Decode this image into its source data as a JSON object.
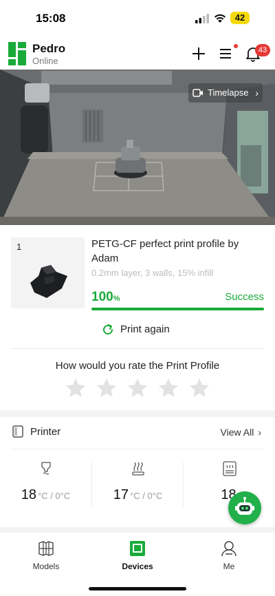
{
  "status_bar": {
    "time": "15:08",
    "battery": "42"
  },
  "header": {
    "device_name": "Pedro",
    "device_status": "Online",
    "notification_count": "43"
  },
  "camera": {
    "timelapse_label": "Timelapse"
  },
  "job": {
    "plate_number": "1",
    "title": "PETG-CF perfect print profile by Adam",
    "subtitle": "0.2mm layer, 3 walls, 15% infill",
    "progress_value": "100",
    "progress_unit": "%",
    "progress_fraction": 1.0,
    "state": "Success",
    "print_again_label": "Print again"
  },
  "rating": {
    "question": "How would you rate the Print Profile",
    "stars_total": 5,
    "stars_selected": 0
  },
  "printer": {
    "title": "Printer",
    "view_all_label": "View All",
    "temps": [
      {
        "value": "18",
        "unit": "°C / 0°C",
        "icon": "nozzle-icon"
      },
      {
        "value": "17",
        "unit": "°C / 0°C",
        "icon": "heatbed-icon"
      },
      {
        "value": "18",
        "unit": "",
        "icon": "chamber-icon"
      }
    ]
  },
  "bottom_nav": [
    {
      "label": "Models",
      "icon": "models-icon",
      "active": false
    },
    {
      "label": "Devices",
      "icon": "devices-icon",
      "active": true
    },
    {
      "label": "Me",
      "icon": "profile-icon",
      "active": false
    }
  ],
  "colors": {
    "accent": "#1aaa3a",
    "badge": "#e53935"
  }
}
